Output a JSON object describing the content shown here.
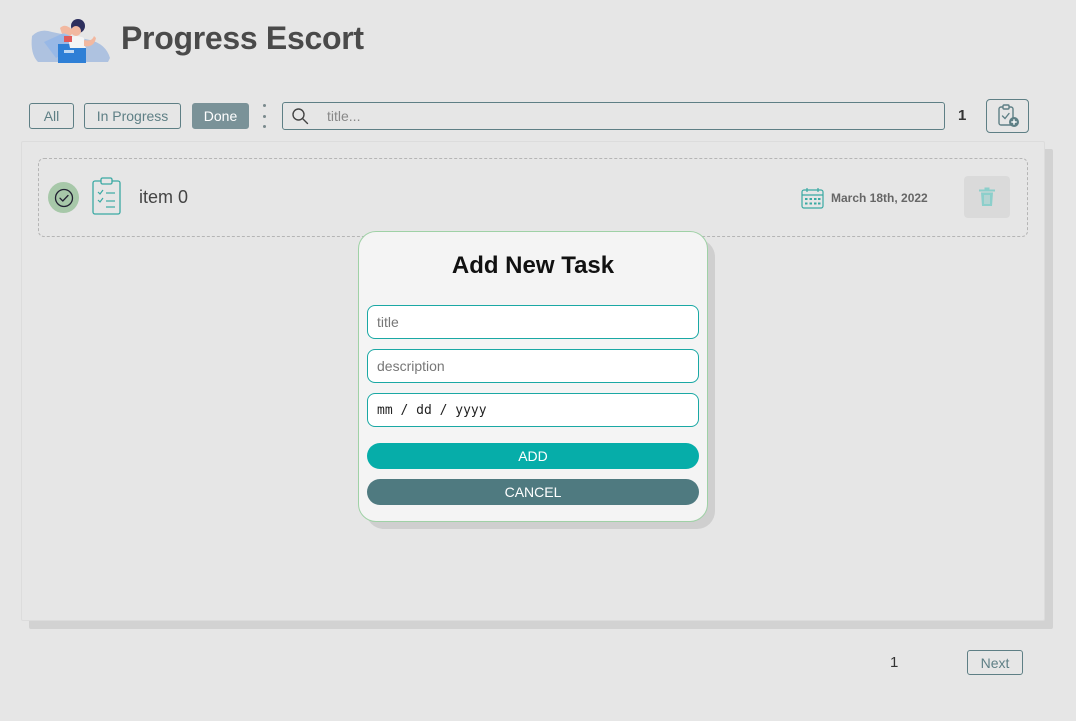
{
  "header": {
    "title": "Progress Escort",
    "logo_icon": "person-with-laptop-illustration"
  },
  "toolbar": {
    "filters": [
      {
        "label": "All",
        "active": false
      },
      {
        "label": "In Progress",
        "active": false
      },
      {
        "label": "Done",
        "active": true
      }
    ],
    "menu_icon": "kebab-menu-icon",
    "search": {
      "placeholder": "title...",
      "value": "",
      "icon": "search-icon"
    },
    "task_count": "1",
    "add_button_icon": "clipboard-add-icon"
  },
  "tasks": [
    {
      "title": "item 0",
      "date": "March 18th, 2022",
      "status": "done",
      "status_icon": "check-circle-icon",
      "type_icon": "clipboard-icon",
      "date_icon": "calendar-icon",
      "delete_icon": "trash-icon"
    }
  ],
  "modal": {
    "title": "Add New Task",
    "title_placeholder": "title",
    "description_placeholder": "description",
    "date_placeholder": "mm / dd / yyyy",
    "add_label": "ADD",
    "cancel_label": "CANCEL"
  },
  "pagination": {
    "current_page": "1",
    "next_label": "Next"
  },
  "colors": {
    "accent": "#06ada9",
    "secondary": "#4f7a80",
    "done_badge": "#a7c8a9",
    "background": "#e6e6e6"
  }
}
